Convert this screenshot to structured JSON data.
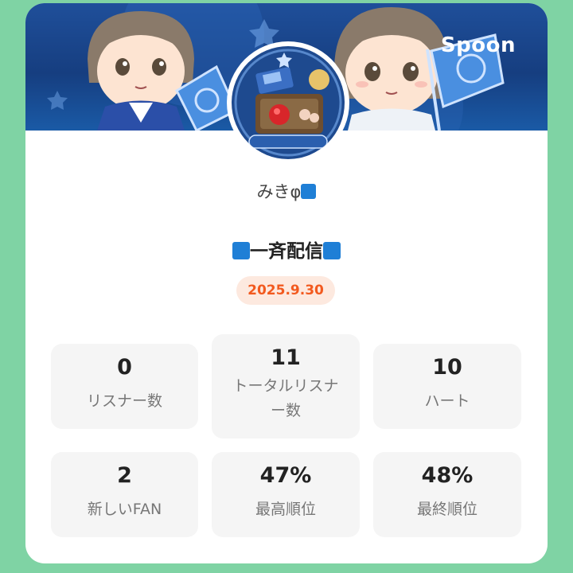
{
  "brand": "Spoon",
  "user": {
    "name": "みきφ"
  },
  "broadcast": {
    "title": "一斉配信",
    "date": "2025.9.30"
  },
  "colors": {
    "background": "#7fd3a4",
    "badge_text": "#f25a1f",
    "badge_bg": "#fde9df",
    "banner": "#1f4f9a"
  },
  "stats": [
    {
      "value": "0",
      "label": "リスナー数"
    },
    {
      "value": "11",
      "label": "トータルリスナー数"
    },
    {
      "value": "10",
      "label": "ハート"
    },
    {
      "value": "2",
      "label": "新しいFAN"
    },
    {
      "value": "47%",
      "label": "最高順位"
    },
    {
      "value": "48%",
      "label": "最終順位"
    }
  ]
}
